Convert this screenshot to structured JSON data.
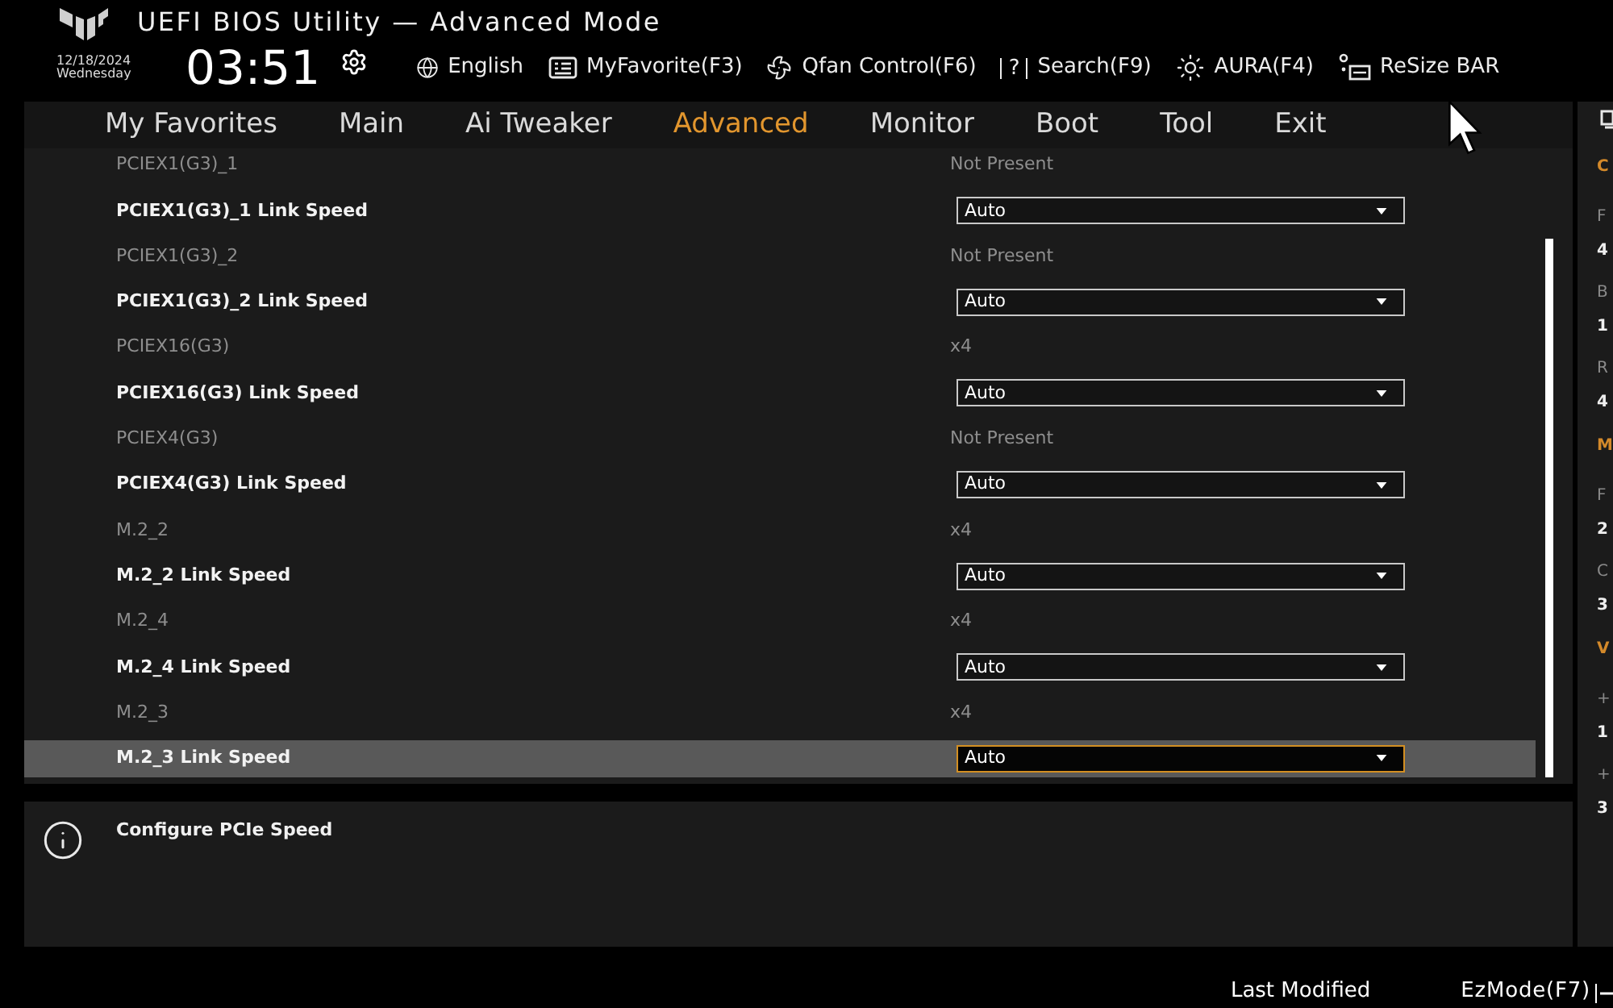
{
  "header": {
    "title": "UEFI BIOS Utility — Advanced Mode",
    "date": "12/18/2024",
    "weekday": "Wednesday",
    "time": "03:51"
  },
  "toolbar": [
    {
      "kind": "language",
      "label": "English"
    },
    {
      "kind": "favorite",
      "label": "MyFavorite(F3)"
    },
    {
      "kind": "fan",
      "label": "Qfan Control(F6)"
    },
    {
      "kind": "search",
      "mark": "?",
      "label": "Search(F9)"
    },
    {
      "kind": "aura",
      "label": "AURA(F4)"
    },
    {
      "kind": "resize_bar",
      "label": "ReSize BAR"
    }
  ],
  "tabs": [
    {
      "label": "My Favorites",
      "selected": false
    },
    {
      "label": "Main",
      "selected": false
    },
    {
      "label": "Ai Tweaker",
      "selected": false
    },
    {
      "label": "Advanced",
      "selected": true
    },
    {
      "label": "Monitor",
      "selected": false
    },
    {
      "label": "Boot",
      "selected": false
    },
    {
      "label": "Tool",
      "selected": false
    },
    {
      "label": "Exit",
      "selected": false
    }
  ],
  "settings": [
    {
      "kind": "info",
      "label": "PCIEX1(G3)_1",
      "value": "Not Present",
      "selected": false
    },
    {
      "kind": "dropdown",
      "label": "PCIEX1(G3)_1 Link Speed",
      "value": "Auto",
      "selected": false
    },
    {
      "kind": "info",
      "label": "PCIEX1(G3)_2",
      "value": "Not Present",
      "selected": false
    },
    {
      "kind": "dropdown",
      "label": "PCIEX1(G3)_2 Link Speed",
      "value": "Auto",
      "selected": false
    },
    {
      "kind": "info",
      "label": "PCIEX16(G3)",
      "value": "x4",
      "selected": false
    },
    {
      "kind": "dropdown",
      "label": "PCIEX16(G3) Link Speed",
      "value": "Auto",
      "selected": false
    },
    {
      "kind": "info",
      "label": "PCIEX4(G3)",
      "value": "Not Present",
      "selected": false
    },
    {
      "kind": "dropdown",
      "label": "PCIEX4(G3) Link Speed",
      "value": "Auto",
      "selected": false
    },
    {
      "kind": "info",
      "label": "M.2_2",
      "value": "x4",
      "selected": false
    },
    {
      "kind": "dropdown",
      "label": "M.2_2 Link Speed",
      "value": "Auto",
      "selected": false
    },
    {
      "kind": "info",
      "label": "M.2_4",
      "value": "x4",
      "selected": false
    },
    {
      "kind": "dropdown",
      "label": "M.2_4 Link Speed",
      "value": "Auto",
      "selected": false
    },
    {
      "kind": "info",
      "label": "M.2_3",
      "value": "x4",
      "selected": false
    },
    {
      "kind": "dropdown",
      "label": "M.2_3 Link Speed",
      "value": "Auto",
      "selected": true
    }
  ],
  "help": {
    "text": "Configure PCIe Speed"
  },
  "hardware_monitor": [
    {
      "kind": "heading",
      "text": "C"
    },
    {
      "kind": "label",
      "text": "F"
    },
    {
      "kind": "value",
      "text": "4"
    },
    {
      "kind": "label",
      "text": "B"
    },
    {
      "kind": "value",
      "text": "1"
    },
    {
      "kind": "label",
      "text": "R"
    },
    {
      "kind": "value",
      "text": "4"
    },
    {
      "kind": "heading",
      "text": "M"
    },
    {
      "kind": "label",
      "text": "F"
    },
    {
      "kind": "value",
      "text": "2"
    },
    {
      "kind": "label",
      "text": "C"
    },
    {
      "kind": "value",
      "text": "3"
    },
    {
      "kind": "heading",
      "text": "V"
    },
    {
      "kind": "label",
      "text": "+"
    },
    {
      "kind": "value",
      "text": "1"
    },
    {
      "kind": "label",
      "text": "+"
    },
    {
      "kind": "value",
      "text": "3"
    }
  ],
  "footer": {
    "last_modified": "Last Modified",
    "ez_mode": "EzMode(F7)"
  }
}
